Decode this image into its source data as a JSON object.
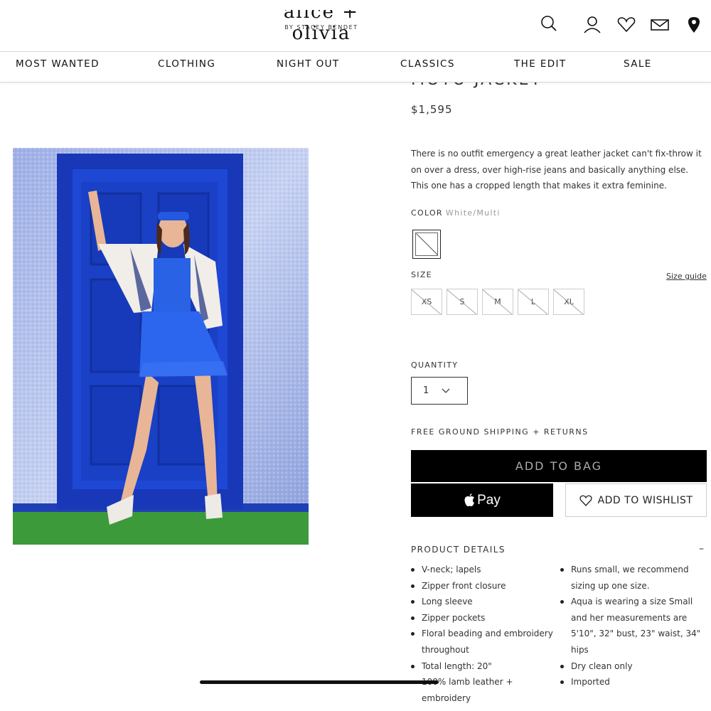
{
  "brand": {
    "name": "alice + olivia",
    "tagline": "BY STACEY BENDET"
  },
  "header_icons": [
    "search-icon",
    "account-icon",
    "wishlist-heart-icon",
    "mail-icon",
    "store-locator-icon"
  ],
  "nav": {
    "items": [
      "MOST WANTED",
      "CLOTHING",
      "NIGHT OUT",
      "CLASSICS",
      "THE EDIT",
      "SALE"
    ]
  },
  "product": {
    "title": "MOTO JACKET",
    "price": "$1,595",
    "description": "There is no outfit emergency a great leather jacket can't fix-throw it on over a dress, over high-rise jeans and basically anything else. This one has a cropped length that makes it extra feminine.",
    "color_label": "COLOR",
    "color_value": "White/Multi",
    "size_label": "SIZE",
    "size_guide": "Size guide",
    "sizes": [
      "XS",
      "S",
      "M",
      "L",
      "XL"
    ],
    "quantity_label": "QUANTITY",
    "quantity_value": "1",
    "shipping_note": "FREE GROUND SHIPPING + RETURNS",
    "add_to_bag": "ADD TO BAG",
    "apple_pay": "Pay",
    "add_to_wishlist": "ADD TO WISHLIST",
    "details_heading": "PRODUCT DETAILS",
    "details_toggle": "–",
    "details_left": [
      "V-neck; lapels",
      "Zipper front closure",
      "Long sleeve",
      "Zipper pockets",
      "Floral beading and embroidery throughout",
      "Total length: 20\"",
      "100% lamb leather + embroidery"
    ],
    "details_right": [
      "Runs small, we recommend sizing up one size.",
      "Aqua is wearing a size Small and her measurements are 5'10\", 32\" bust, 23\" waist, 34\" hips",
      "Dry clean only",
      "Imported"
    ]
  },
  "colors": {
    "accent_blue": "#1f46c8",
    "button_black": "#000000"
  }
}
